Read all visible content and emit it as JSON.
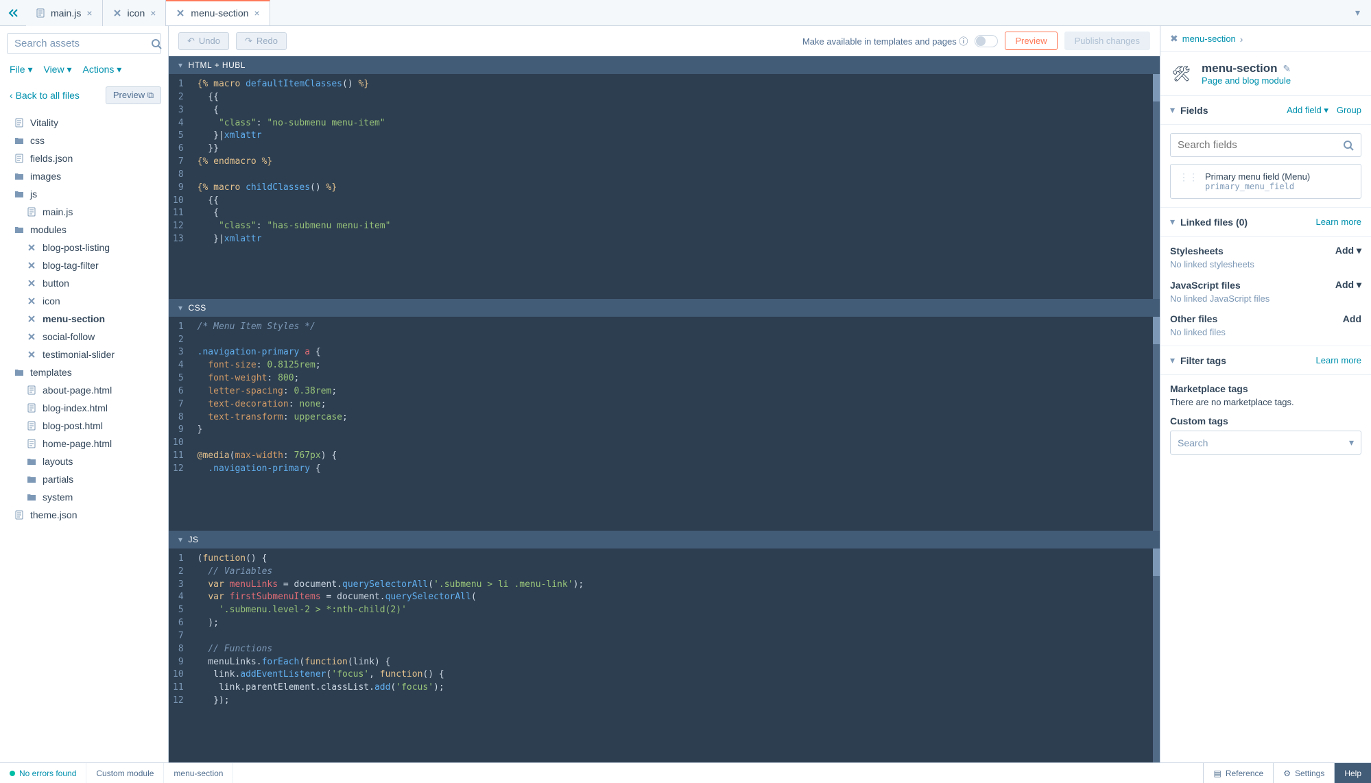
{
  "tabs": [
    {
      "label": "main.js",
      "icon": "page"
    },
    {
      "label": "icon",
      "icon": "module"
    },
    {
      "label": "menu-section",
      "icon": "module",
      "active": true
    }
  ],
  "sidebar": {
    "search_placeholder": "Search assets",
    "menu": {
      "file": "File",
      "view": "View",
      "actions": "Actions"
    },
    "back": "Back to all files",
    "preview": "Preview",
    "tree": [
      {
        "label": "Vitality",
        "icon": "page",
        "indent": 0
      },
      {
        "label": "css",
        "icon": "folder",
        "indent": 0
      },
      {
        "label": "fields.json",
        "icon": "page",
        "indent": 0
      },
      {
        "label": "images",
        "icon": "folder",
        "indent": 0
      },
      {
        "label": "js",
        "icon": "folder",
        "indent": 0
      },
      {
        "label": "main.js",
        "icon": "page",
        "indent": 1
      },
      {
        "label": "modules",
        "icon": "folder",
        "indent": 0
      },
      {
        "label": "blog-post-listing",
        "icon": "module",
        "indent": 1
      },
      {
        "label": "blog-tag-filter",
        "icon": "module",
        "indent": 1
      },
      {
        "label": "button",
        "icon": "module",
        "indent": 1
      },
      {
        "label": "icon",
        "icon": "module",
        "indent": 1
      },
      {
        "label": "menu-section",
        "icon": "module",
        "indent": 1,
        "bold": true
      },
      {
        "label": "social-follow",
        "icon": "module",
        "indent": 1
      },
      {
        "label": "testimonial-slider",
        "icon": "module",
        "indent": 1
      },
      {
        "label": "templates",
        "icon": "folder",
        "indent": 0
      },
      {
        "label": "about-page.html",
        "icon": "page",
        "indent": 1
      },
      {
        "label": "blog-index.html",
        "icon": "page",
        "indent": 1
      },
      {
        "label": "blog-post.html",
        "icon": "page",
        "indent": 1
      },
      {
        "label": "home-page.html",
        "icon": "page",
        "indent": 1
      },
      {
        "label": "layouts",
        "icon": "folder",
        "indent": 1
      },
      {
        "label": "partials",
        "icon": "folder",
        "indent": 1
      },
      {
        "label": "system",
        "icon": "folder",
        "indent": 1
      },
      {
        "label": "theme.json",
        "icon": "page",
        "indent": 0
      }
    ]
  },
  "toolbar": {
    "undo": "Undo",
    "redo": "Redo",
    "available": "Make available in templates and pages",
    "preview": "Preview",
    "publish": "Publish changes"
  },
  "panes": {
    "html": "HTML + HUBL",
    "css": "CSS",
    "js": "JS"
  },
  "code": {
    "html_lines": 13,
    "css_lines": 12,
    "js_lines": 12
  },
  "right": {
    "breadcrumb": "menu-section",
    "title": "menu-section",
    "subtitle": "Page and blog module",
    "fields_title": "Fields",
    "add_field": "Add field",
    "group": "Group",
    "fields_search": "Search fields",
    "field_name": "Primary menu field (Menu)",
    "field_code": "primary_menu_field",
    "linked_title": "Linked files (0)",
    "learn_more": "Learn more",
    "stylesheets": "Stylesheets",
    "no_stylesheets": "No linked stylesheets",
    "js_files": "JavaScript files",
    "no_js": "No linked JavaScript files",
    "other_files": "Other files",
    "no_other": "No linked files",
    "add": "Add",
    "filter_tags": "Filter tags",
    "marketplace": "Marketplace tags",
    "no_marketplace": "There are no marketplace tags.",
    "custom_tags": "Custom tags",
    "search": "Search"
  },
  "footer": {
    "errors": "No errors found",
    "type": "Custom module",
    "name": "menu-section",
    "reference": "Reference",
    "settings": "Settings",
    "help": "Help"
  }
}
